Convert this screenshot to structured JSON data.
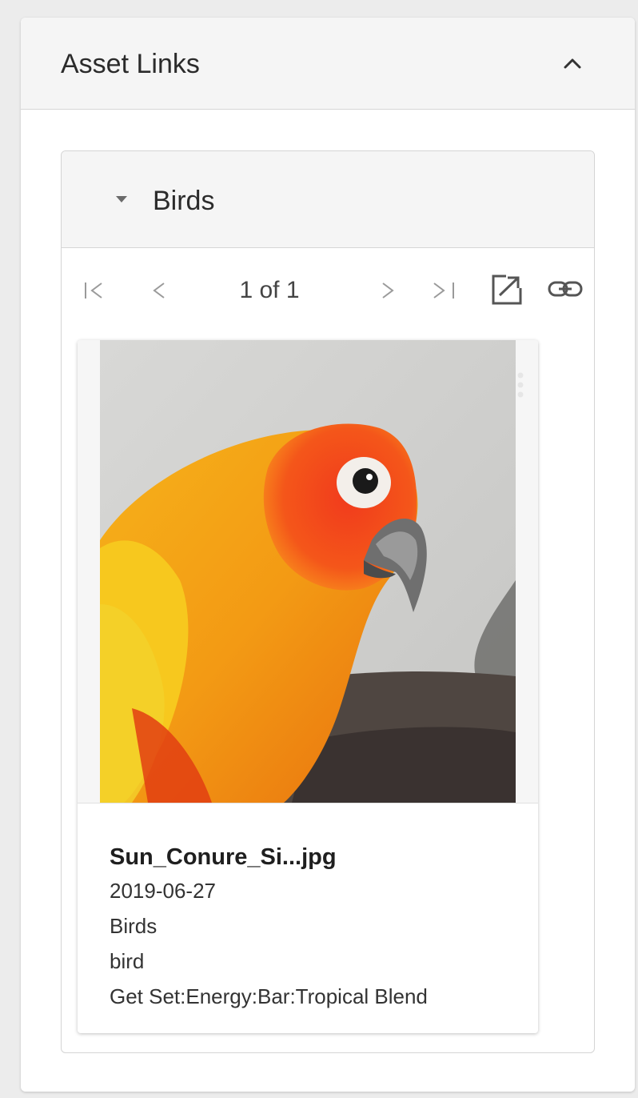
{
  "panel": {
    "title": "Asset Links",
    "collapse_icon": "chevron-up-icon"
  },
  "section": {
    "title": "Birds",
    "expand_icon": "caret-down-icon"
  },
  "pager": {
    "page_text": "1 of 1",
    "icons": [
      "first-page-icon",
      "previous-page-icon",
      "next-page-icon",
      "last-page-icon",
      "open-external-icon",
      "link-icon"
    ]
  },
  "card": {
    "image_subject": "sun conure parrot photo",
    "file_name": "Sun_Conure_Si...jpg",
    "date": "2019-06-27",
    "category": "Birds",
    "keyword": "bird",
    "product": "Get Set:Energy:Bar:Tropical Blend"
  },
  "colors": {
    "header_bg": "#f5f5f5",
    "icon_gray": "#9a9a9a",
    "icon_dark": "#555555"
  }
}
